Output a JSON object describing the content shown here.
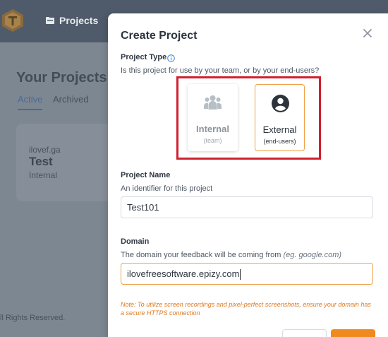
{
  "background": {
    "nav": {
      "projects_label": "Projects"
    },
    "page_title": "Your Projects",
    "tabs": [
      {
        "label": "Active",
        "active": true
      },
      {
        "label": "Archived",
        "active": false
      }
    ],
    "project_card": {
      "domain": "ilovef.ga",
      "name": "Test",
      "type": "Internal"
    },
    "footer_text": "ll Rights Reserved."
  },
  "modal": {
    "title": "Create Project",
    "project_type": {
      "label": "Project Type",
      "help": "Is this project for use by your team, or by your end-users?",
      "options": [
        {
          "name": "Internal",
          "sub": "(team)",
          "icon": "users-icon",
          "selected": false
        },
        {
          "name": "External",
          "sub": "(end-users)",
          "icon": "user-circle-icon",
          "selected": true
        }
      ]
    },
    "project_name": {
      "label": "Project Name",
      "help": "An identifier for this project",
      "value": "Test101"
    },
    "domain": {
      "label": "Domain",
      "help": "The domain your feedback will be coming from",
      "help_example": "(eg. google.com)",
      "value": "ilovefreesoftware.epizy.com"
    },
    "note": "Note: To utilize screen recordings and pixel-perfect screenshots, ensure your domain has a secure HTTPS connection"
  },
  "colors": {
    "accent": "#ef8a1f",
    "highlight_frame": "#d0202f",
    "overlay": "#7b8590"
  }
}
